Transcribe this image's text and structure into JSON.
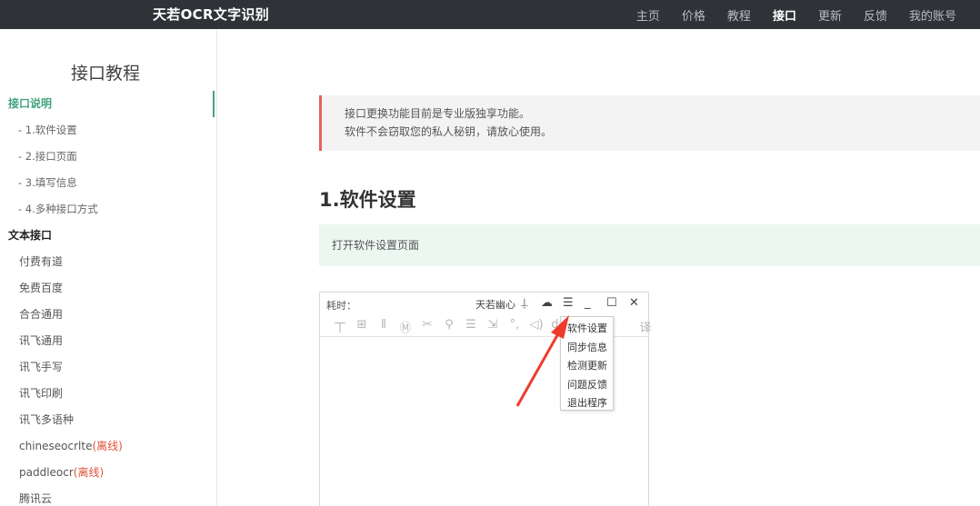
{
  "header": {
    "brand": "天若OCR文字识别",
    "nav": [
      "主页",
      "价格",
      "教程",
      "接口",
      "更新",
      "反馈",
      "我的账号"
    ],
    "active_index": 3
  },
  "sidebar": {
    "title": "接口教程",
    "items": [
      {
        "type": "h",
        "label": "接口说明",
        "active": true
      },
      {
        "type": "sub",
        "label": "- 1.软件设置"
      },
      {
        "type": "sub",
        "label": "- 2.接口页面"
      },
      {
        "type": "sub",
        "label": "- 3.填写信息"
      },
      {
        "type": "sub",
        "label": "- 4.多种接口方式"
      },
      {
        "type": "h",
        "label": "文本接口"
      },
      {
        "type": "leaf",
        "label": "付费有道"
      },
      {
        "type": "leaf",
        "label": "免费百度"
      },
      {
        "type": "leaf",
        "label": "合合通用"
      },
      {
        "type": "leaf",
        "label": "讯飞通用"
      },
      {
        "type": "leaf",
        "label": "讯飞手写"
      },
      {
        "type": "leaf",
        "label": "讯飞印刷"
      },
      {
        "type": "leaf",
        "label": "讯飞多语种"
      },
      {
        "type": "leaf",
        "label": "chineseocrlte",
        "badge": "(离线)"
      },
      {
        "type": "leaf",
        "label": "paddleocr",
        "badge": "(离线)"
      },
      {
        "type": "leaf",
        "label": "腾讯云"
      }
    ]
  },
  "main": {
    "notice_lines": [
      "接口更换功能目前是专业版独享功能。",
      "软件不会窃取您的私人秘钥，请放心使用。"
    ],
    "section_title": "1.软件设置",
    "tip": "打开软件设置页面"
  },
  "app_mock": {
    "time_label": "耗时：",
    "app_name": "天若幽心",
    "toolbar_glyphs": [
      "丅",
      "⊞",
      "⫴",
      "Ⓜ",
      "✂",
      "⚲",
      "☰",
      "⇲",
      "°,",
      "◁)",
      "dc",
      "",
      "",
      "",
      "译"
    ],
    "menu_items": [
      "软件设置",
      "同步信息",
      "检测更新",
      "问题反馈",
      "退出程序"
    ],
    "arrow_color": "#f03b2b"
  },
  "colors": {
    "topbar": "#2f3237",
    "accent_green": "#42a37e",
    "notice_border": "#e8605a",
    "offline_red": "#e4503c"
  }
}
